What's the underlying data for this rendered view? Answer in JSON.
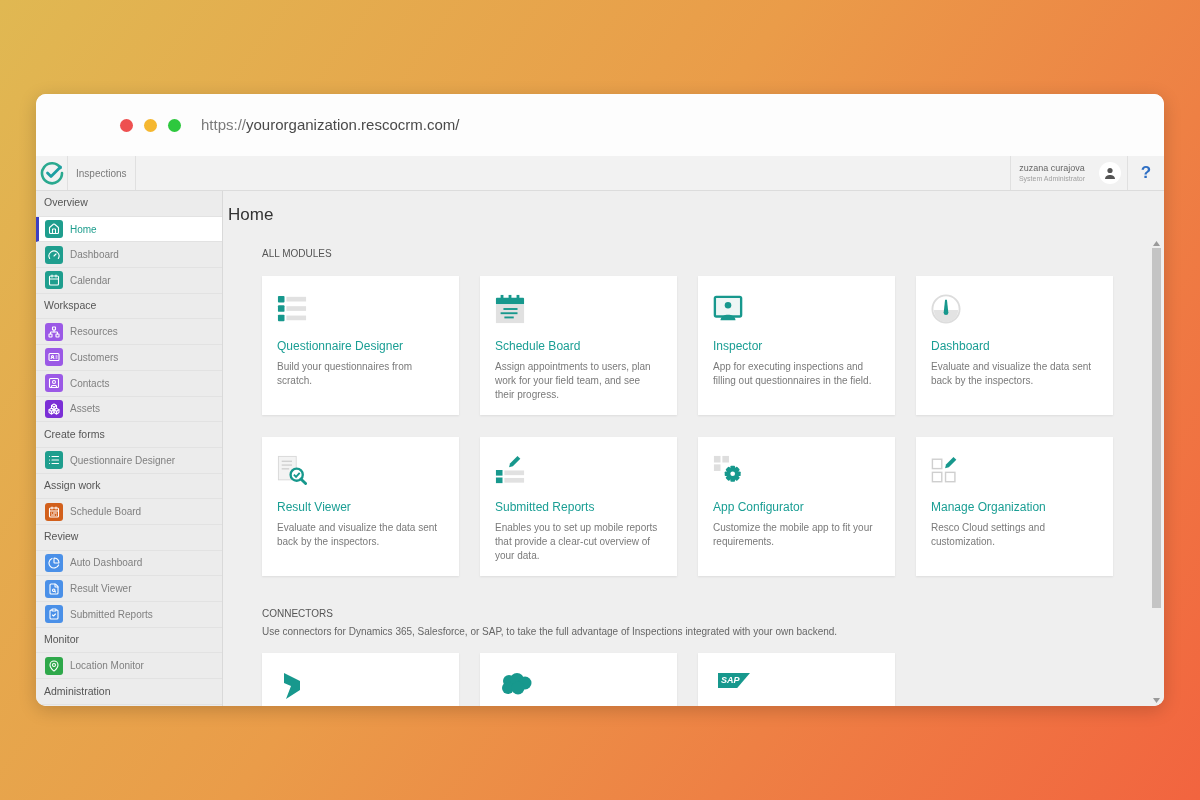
{
  "browser": {
    "url": {
      "scheme": "https://",
      "address": "yourorganization.rescocrm.com/"
    }
  },
  "app_bar": {
    "app_name": "Inspections",
    "user": {
      "name": "zuzana curajova",
      "role": "System Administrator"
    },
    "help": "?"
  },
  "sidebar": {
    "groups": [
      {
        "heading": "Overview",
        "items": [
          {
            "label": "Home",
            "color": "#1f9e8e",
            "selected": true
          },
          {
            "label": "Dashboard",
            "color": "#1f9e8e",
            "selected": false
          },
          {
            "label": "Calendar",
            "color": "#1f9e8e",
            "selected": false
          }
        ]
      },
      {
        "heading": "Workspace",
        "items": [
          {
            "label": "Resources",
            "color": "#9b59e6",
            "selected": false
          },
          {
            "label": "Customers",
            "color": "#9b59e6",
            "selected": false
          },
          {
            "label": "Contacts",
            "color": "#9b59e6",
            "selected": false
          },
          {
            "label": "Assets",
            "color": "#7b2fd6",
            "selected": false
          }
        ]
      },
      {
        "heading": "Create forms",
        "items": [
          {
            "label": "Questionnaire Designer",
            "color": "#1f9e8e",
            "selected": false
          }
        ]
      },
      {
        "heading": "Assign work",
        "items": [
          {
            "label": "Schedule Board",
            "color": "#d2601c",
            "selected": false
          }
        ]
      },
      {
        "heading": "Review",
        "items": [
          {
            "label": "Auto Dashboard",
            "color": "#4a90e8",
            "selected": false
          },
          {
            "label": "Result Viewer",
            "color": "#4a90e8",
            "selected": false
          },
          {
            "label": "Submitted Reports",
            "color": "#4a90e8",
            "selected": false
          }
        ]
      },
      {
        "heading": "Monitor",
        "items": [
          {
            "label": "Location Monitor",
            "color": "#2ea84a",
            "selected": false
          }
        ]
      },
      {
        "heading": "Administration"
      }
    ]
  },
  "main": {
    "title": "Home",
    "modules": {
      "heading": "ALL MODULES",
      "cards": [
        {
          "title": "Questionnaire Designer",
          "description": "Build your questionnaires from scratch."
        },
        {
          "title": "Schedule Board",
          "description": "Assign appointments to users, plan work for your field team, and see their progress."
        },
        {
          "title": "Inspector",
          "description": "App for executing inspections and filling out questionnaires in the field."
        },
        {
          "title": "Dashboard",
          "description": "Evaluate and visualize the data sent back by the inspectors."
        },
        {
          "title": "Result Viewer",
          "description": "Evaluate and visualize the data sent back by the inspectors."
        },
        {
          "title": "Submitted Reports",
          "description": "Enables you to set up mobile reports that provide a clear-cut overview of your data."
        },
        {
          "title": "App Configurator",
          "description": "Customize the mobile app to fit your requirements."
        },
        {
          "title": "Manage Organization",
          "description": "Resco Cloud settings and customization."
        }
      ]
    },
    "connectors": {
      "heading": "CONNECTORS",
      "description": "Use connectors for Dynamics 365, Salesforce, or SAP, to take the full advantage of Inspections integrated with your own backend.",
      "cards": [
        {
          "kind": "logo"
        },
        {
          "kind": "logo"
        },
        {
          "kind": "wordmark",
          "text": "SAP"
        }
      ]
    }
  }
}
